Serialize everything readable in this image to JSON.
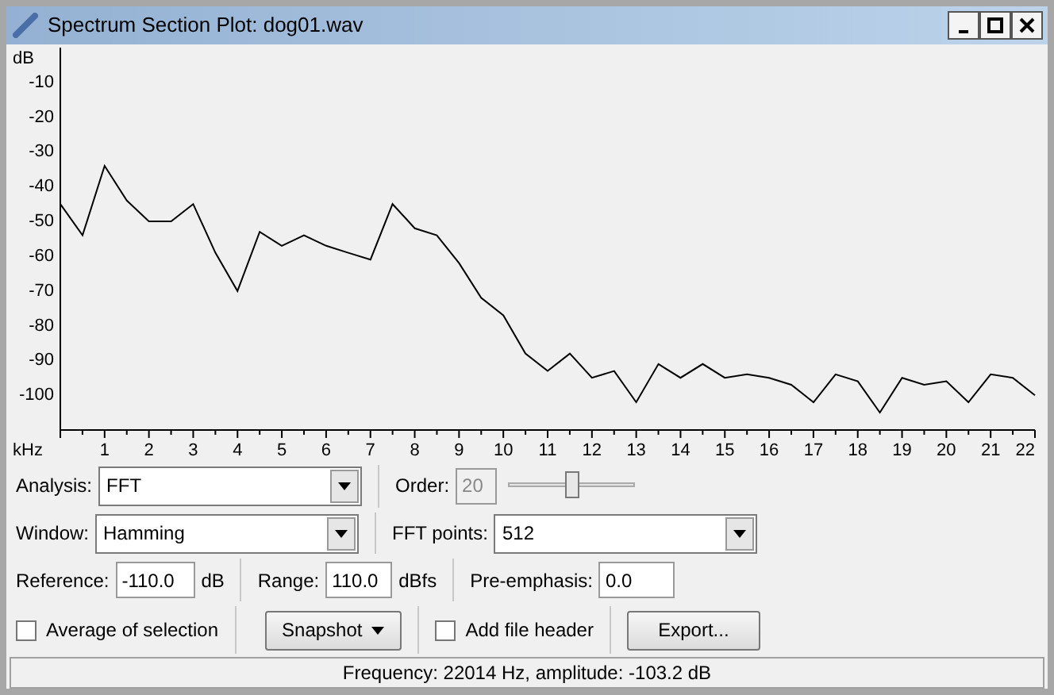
{
  "window": {
    "title": "Spectrum Section Plot: dog01.wav"
  },
  "plot": {
    "chart_data": {
      "type": "line",
      "xlabel": "kHz",
      "ylabel": "dB",
      "xlim": [
        0,
        22
      ],
      "ylim": [
        -110,
        0
      ],
      "xticks": [
        1,
        2,
        3,
        4,
        5,
        6,
        7,
        8,
        9,
        10,
        11,
        12,
        13,
        14,
        15,
        16,
        17,
        18,
        19,
        20,
        21,
        22
      ],
      "yticks": [
        -10,
        -20,
        -30,
        -40,
        -50,
        -60,
        -70,
        -80,
        -90,
        -100
      ],
      "x": [
        0,
        0.5,
        1,
        1.5,
        2,
        2.5,
        3,
        3.5,
        4,
        4.5,
        5,
        5.5,
        6,
        6.5,
        7,
        7.5,
        8,
        8.5,
        9,
        9.5,
        10,
        10.5,
        11,
        11.5,
        12,
        12.5,
        13,
        13.5,
        14,
        14.5,
        15,
        15.5,
        16,
        16.5,
        17,
        17.5,
        18,
        18.5,
        19,
        19.5,
        20,
        20.5,
        21,
        21.5,
        22
      ],
      "series": [
        {
          "color": "#000000",
          "values": [
            -45,
            -54,
            -34,
            -44,
            -50,
            -50,
            -45,
            -59,
            -70,
            -53,
            -57,
            -54,
            -57,
            -59,
            -61,
            -45,
            -52,
            -54,
            -62,
            -72,
            -77,
            -88,
            -93,
            -88,
            -95,
            -93,
            -102,
            -91,
            -95,
            -91,
            -95,
            -94,
            -95,
            -97,
            -102,
            -94,
            -96,
            -105,
            -95,
            -97,
            -96,
            -102,
            -94,
            -95,
            -100
          ]
        }
      ]
    }
  },
  "controls": {
    "analysis": {
      "label": "Analysis:",
      "value": "FFT"
    },
    "order": {
      "label": "Order:",
      "value": "20",
      "disabled": true,
      "level": 0.5
    },
    "window": {
      "label": "Window:",
      "value": "Hamming"
    },
    "fft_points": {
      "label": "FFT points:",
      "value": "512"
    },
    "reference": {
      "label": "Reference:",
      "value": "-110.0",
      "unit": "dB"
    },
    "range": {
      "label": "Range:",
      "value": "110.0",
      "unit": "dBfs"
    },
    "pre_emphasis": {
      "label": "Pre-emphasis:",
      "value": "0.0"
    },
    "average": {
      "label": "Average of selection",
      "checked": false
    },
    "snapshot": {
      "label": "Snapshot"
    },
    "file_header": {
      "label": "Add file header",
      "checked": false
    },
    "export": {
      "label": "Export..."
    }
  },
  "status_bar": "Frequency: 22014 Hz, amplitude: -103.2 dB"
}
